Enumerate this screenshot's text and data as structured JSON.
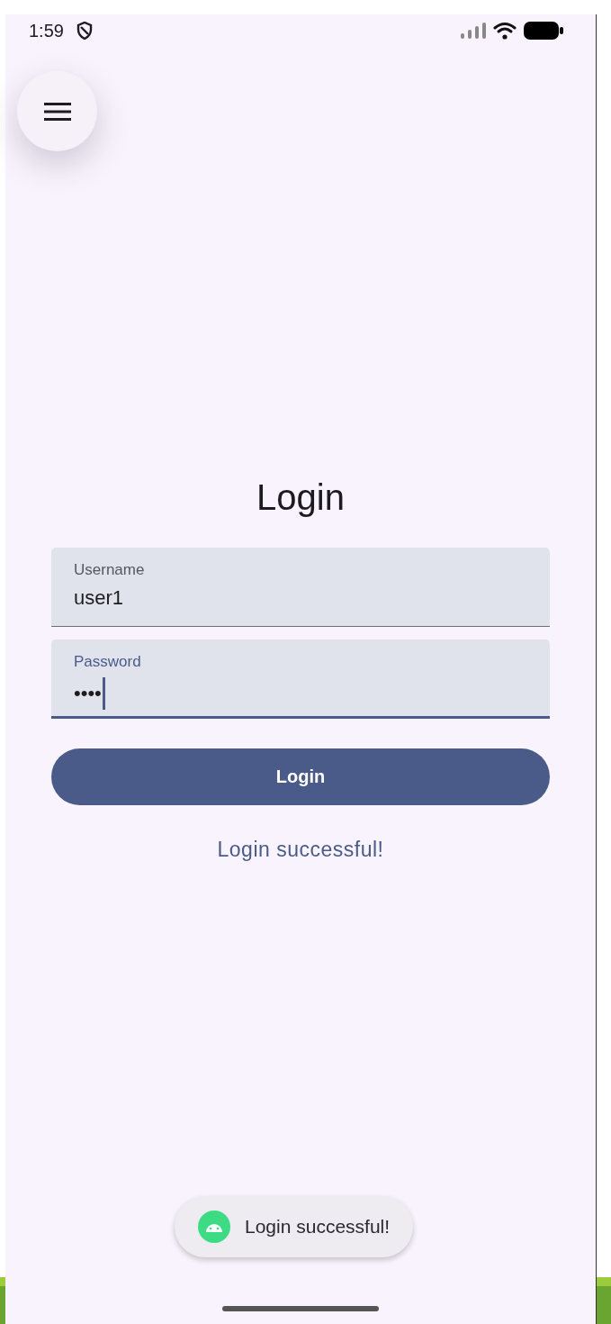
{
  "status_bar": {
    "time": "1:59"
  },
  "title": "Login",
  "fields": [
    {
      "label": "Username",
      "value": "user1",
      "focused": false
    },
    {
      "label": "Password",
      "value": "••••",
      "focused": true
    }
  ],
  "login_button": {
    "label": "Login"
  },
  "status_message": "Login successful!",
  "toast": {
    "message": "Login successful!"
  }
}
